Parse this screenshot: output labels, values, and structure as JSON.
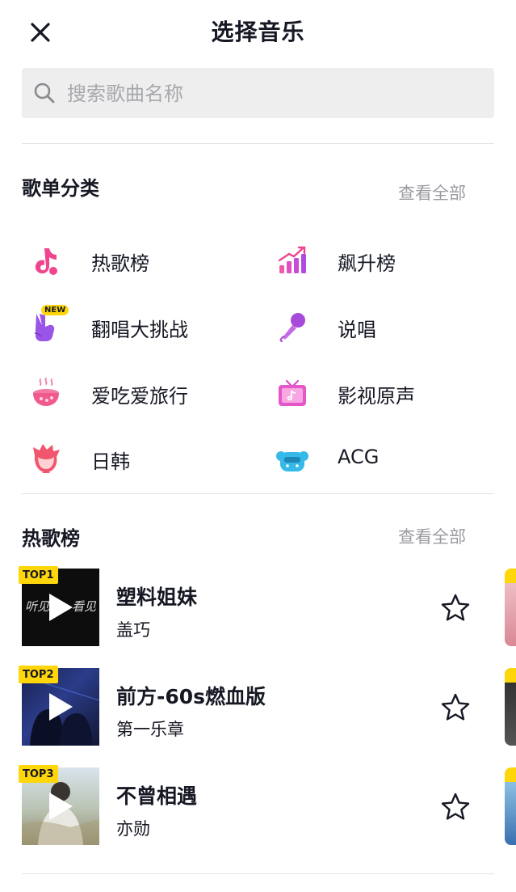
{
  "header": {
    "title": "选择音乐"
  },
  "search": {
    "placeholder": "搜索歌曲名称"
  },
  "playlist_categories": {
    "title": "歌单分类",
    "view_all": "查看全部",
    "badge_new": "NEW",
    "items": [
      {
        "label": "热歌榜",
        "icon": "tiktok-note-icon"
      },
      {
        "label": "飙升榜",
        "icon": "rising-chart-icon"
      },
      {
        "label": "翻唱大挑战",
        "icon": "victory-hand-icon"
      },
      {
        "label": "说唱",
        "icon": "microphone-icon"
      },
      {
        "label": "爱吃爱旅行",
        "icon": "food-bowl-icon"
      },
      {
        "label": "影视原声",
        "icon": "tv-icon"
      },
      {
        "label": "日韩",
        "icon": "anime-character-icon"
      },
      {
        "label": "ACG",
        "icon": "acg-mascot-icon"
      }
    ]
  },
  "hot_songs": {
    "title": "热歌榜",
    "view_all": "查看全部",
    "songs": [
      {
        "rank": "TOP1",
        "title": "塑料姐妹",
        "artist": "盖巧",
        "cover_text_left": "听见",
        "cover_text_right": "看见"
      },
      {
        "rank": "TOP2",
        "title": "前方-60s燃血版",
        "artist": "第一乐章"
      },
      {
        "rank": "TOP3",
        "title": "不曾相遇",
        "artist": "亦勋"
      }
    ]
  },
  "colors": {
    "badge": "#ffd60a",
    "icon_pink": "#f0458e",
    "icon_purple": "#a64bd9",
    "muted_text": "#9a9ba0"
  }
}
